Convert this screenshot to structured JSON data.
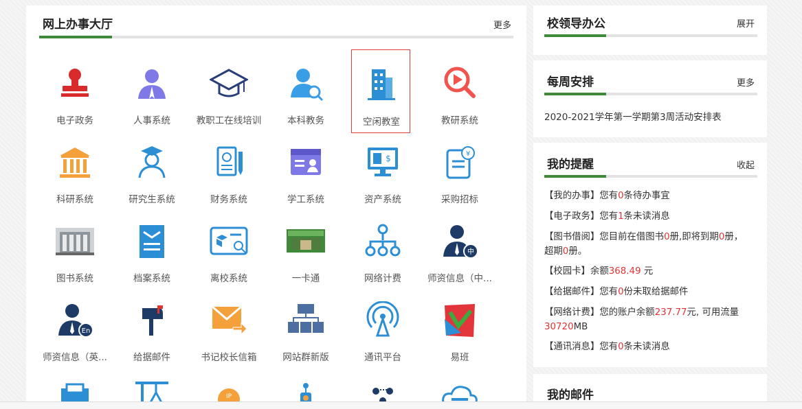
{
  "hall": {
    "title": "网上办事大厅",
    "more": "更多",
    "apps": [
      {
        "label": "电子政务",
        "icon": "stamp-icon"
      },
      {
        "label": "人事系统",
        "icon": "person-icon"
      },
      {
        "label": "教职工在线培训",
        "icon": "graduation-cap-icon"
      },
      {
        "label": "本科教务",
        "icon": "user-search-icon"
      },
      {
        "label": "空闲教室",
        "icon": "building-icon"
      },
      {
        "label": "教研系统",
        "icon": "play-search-icon"
      },
      {
        "label": "科研系统",
        "icon": "institution-icon"
      },
      {
        "label": "研究生系统",
        "icon": "graduate-student-icon"
      },
      {
        "label": "财务系统",
        "icon": "finance-document-icon"
      },
      {
        "label": "学工系统",
        "icon": "student-calendar-icon"
      },
      {
        "label": "资产系统",
        "icon": "computer-asset-icon"
      },
      {
        "label": "采购招标",
        "icon": "purchase-clipboard-icon"
      },
      {
        "label": "图书系统",
        "icon": "library-photo-icon"
      },
      {
        "label": "档案系统",
        "icon": "archive-folder-icon"
      },
      {
        "label": "离校系统",
        "icon": "id-card-icon"
      },
      {
        "label": "一卡通",
        "icon": "campus-card-icon"
      },
      {
        "label": "网络计费",
        "icon": "network-tree-icon"
      },
      {
        "label": "师资信息（中...",
        "icon": "teacher-cn-icon"
      },
      {
        "label": "师资信息（英...",
        "icon": "teacher-en-icon"
      },
      {
        "label": "给据邮件",
        "icon": "mailbox-icon"
      },
      {
        "label": "书记校长信箱",
        "icon": "mail-forward-icon"
      },
      {
        "label": "网站群新版",
        "icon": "website-group-icon"
      },
      {
        "label": "通讯平台",
        "icon": "antenna-icon"
      },
      {
        "label": "易班",
        "icon": "yiban-logo-icon"
      }
    ]
  },
  "leaders": {
    "title": "校领导办公",
    "toggle": "展开"
  },
  "weekly": {
    "title": "每周安排",
    "more": "更多",
    "item": "2020-2021学年第一学期第3周活动安排表"
  },
  "reminders": {
    "title": "我的提醒",
    "toggle": "收起",
    "lines": [
      {
        "a": "【我的办事】您有",
        "n": "0",
        "b": "条待办事宜"
      },
      {
        "a": "【电子政务】您有",
        "n": "1",
        "b": "条未读消息"
      },
      {
        "a": "【图书借阅】您目前在借图书",
        "n": "0",
        "b": "册,即将到期",
        "n2": "0",
        "c": "册，超期",
        "n3": "0",
        "d": "册。"
      },
      {
        "a": "【校园卡】余额",
        "n": "368.49",
        "b": " 元"
      },
      {
        "a": "【给据邮件】您有",
        "n": "0",
        "b": "份未取给据邮件"
      },
      {
        "a": "【网络计费】您的账户余额",
        "n": "237.77",
        "b": "元, 可用流量",
        "n2": "30720",
        "c": "MB"
      },
      {
        "a": "【通讯消息】您有",
        "n": "0",
        "b": "条未读消息"
      }
    ]
  },
  "mail": {
    "title": "我的邮件"
  },
  "colors": {
    "accent_green": "#3e8a3a",
    "highlight_red": "#e23434",
    "icon_blue": "#2c8fd6",
    "icon_orange": "#f4a13c"
  }
}
